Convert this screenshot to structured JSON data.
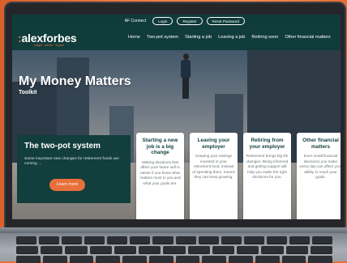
{
  "topbar": {
    "af_connect": "AF Connect",
    "login": "Login",
    "register": "Register",
    "reset_password": "Reset Password"
  },
  "brand": {
    "logo_prefix": ":",
    "logo_name": "alexforbes",
    "tagline": "insight · advice · impact"
  },
  "nav": {
    "items": [
      "Home",
      "Two-pot system",
      "Starting a job",
      "Leaving a job",
      "Retiring soon",
      "Other financial matters"
    ]
  },
  "hero": {
    "title": "My Money Matters",
    "subtitle": "Toolkit"
  },
  "promo": {
    "title": "The two-pot system",
    "text": "Some important new changes for retirement funds are coming ...",
    "button": "Learn more"
  },
  "cards": [
    {
      "title": "Starting a new job is a big change",
      "text": "Making decisions that affect your future self is easier if you know what matters most to you and what your goals are."
    },
    {
      "title": "Leaving your employer",
      "text": "Keeping your savings invested in your retirement fund, instead of spending them, means they can keep growing."
    },
    {
      "title": "Retiring from your employer",
      "text": "Retirement brings big life changes. Being informed and getting support will help you make the right decisions for you."
    },
    {
      "title": "Other financial matters",
      "text": "Even small financial decisions you make every day can affect your ability to reach your goals."
    }
  ],
  "colors": {
    "brand_teal": "#103c3b",
    "accent_orange": "#e8703a",
    "wall": "#ee7d45"
  }
}
